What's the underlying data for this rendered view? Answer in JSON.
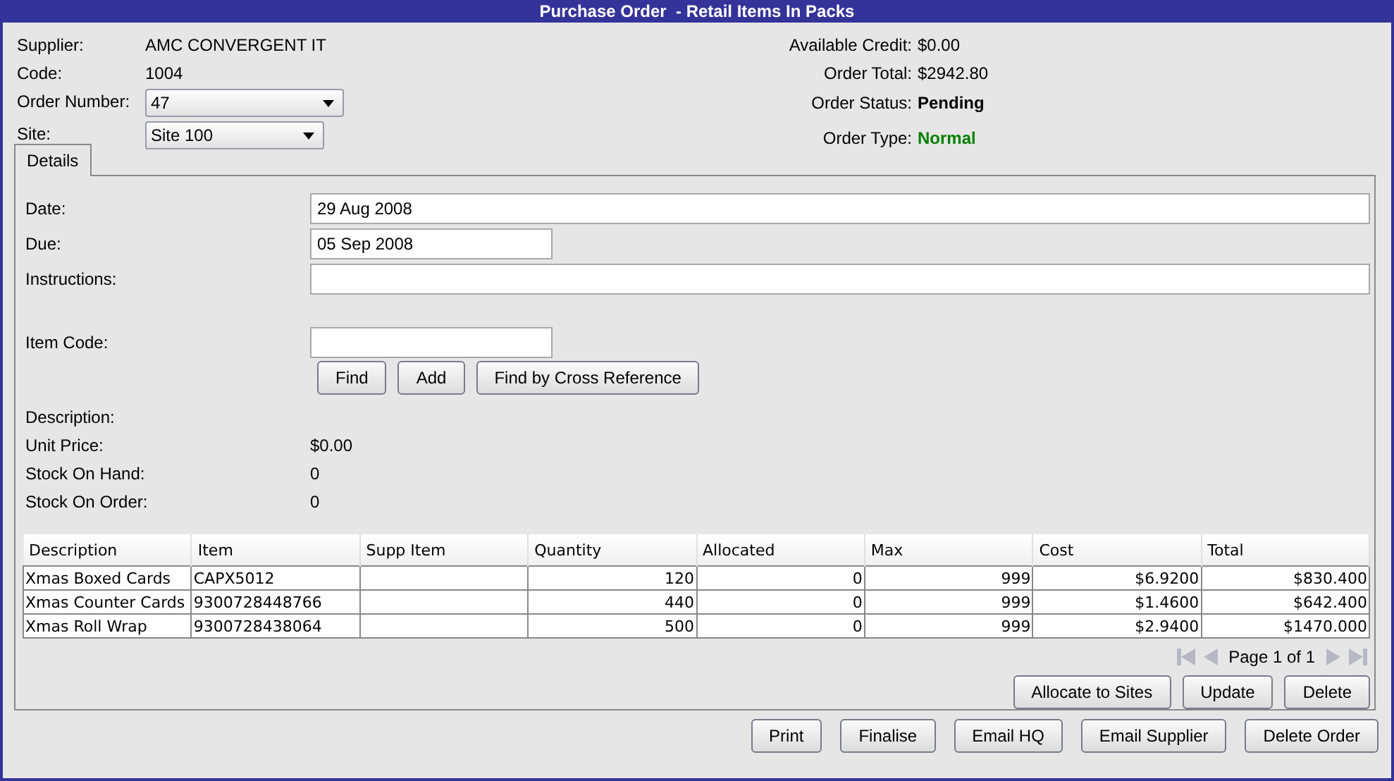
{
  "window": {
    "title": "Purchase Order  - Retail Items In Packs"
  },
  "summary_left": [
    {
      "label": "Supplier:",
      "value": "AMC CONVERGENT IT",
      "kind": "text"
    },
    {
      "label": "Code:",
      "value": "1004",
      "kind": "text"
    },
    {
      "label": "Order Number:",
      "value": "47",
      "kind": "dropdown"
    },
    {
      "label": "Site:",
      "value": "Site 100",
      "kind": "dropdown"
    }
  ],
  "summary_right": [
    {
      "label": "Available Credit:",
      "value": "$0.00",
      "kind": "plain"
    },
    {
      "label": "Order Total:",
      "value": "$2942.80",
      "kind": "plain"
    },
    {
      "label": "Order Status:",
      "value": "Pending",
      "kind": "status",
      "color": "#000000"
    },
    {
      "label": "Order Type:",
      "value": "Normal",
      "kind": "status",
      "color": "#008000"
    }
  ],
  "tabs": [
    {
      "label": "Details",
      "selected": true
    }
  ],
  "fields": [
    {
      "label": "Date:",
      "value": "29 Aug 2008",
      "kind": "wide"
    },
    {
      "label": "Due:",
      "value": "05 Sep 2008",
      "kind": "short"
    },
    {
      "label": "Instructions:",
      "kind": "wide"
    }
  ],
  "item_code": {
    "label": "Item Code:"
  },
  "search_buttons": [
    "Find",
    "Add",
    "Find by Cross Reference"
  ],
  "item_info": [
    {
      "label": "Description:"
    },
    {
      "label": "Unit Price:",
      "value": "$0.00"
    },
    {
      "label": "Stock On Hand:",
      "value": "0"
    },
    {
      "label": "Stock On Order:",
      "value": "0"
    }
  ],
  "table": {
    "columns": [
      {
        "label": "Description",
        "kind": "text"
      },
      {
        "label": "Item",
        "kind": "text"
      },
      {
        "label": "Supp Item",
        "kind": "text"
      },
      {
        "label": "Quantity",
        "kind": "number"
      },
      {
        "label": "Allocated",
        "kind": "number"
      },
      {
        "label": "Max",
        "kind": "number"
      },
      {
        "label": "Cost",
        "kind": "number"
      },
      {
        "label": "Total",
        "kind": "number"
      }
    ],
    "rows": [
      [
        "Xmas Boxed Cards",
        "CAPX5012",
        "",
        "120",
        "0",
        "999",
        "$6.9200",
        "$830.400"
      ],
      [
        "Xmas Counter Cards",
        "9300728448766",
        "",
        "440",
        "0",
        "999",
        "$1.4600",
        "$642.400"
      ],
      [
        "Xmas Roll Wrap",
        "9300728438064",
        "",
        "500",
        "0",
        "999",
        "$2.9400",
        "$1470.000"
      ]
    ]
  },
  "pager": {
    "label": "Page 1 of 1",
    "disabled": true
  },
  "table_buttons": [
    "Allocate to Sites",
    "Update",
    "Delete"
  ],
  "footer_buttons": [
    "Print",
    "Finalise",
    "Email HQ",
    "Email Supplier",
    "Delete Order"
  ]
}
